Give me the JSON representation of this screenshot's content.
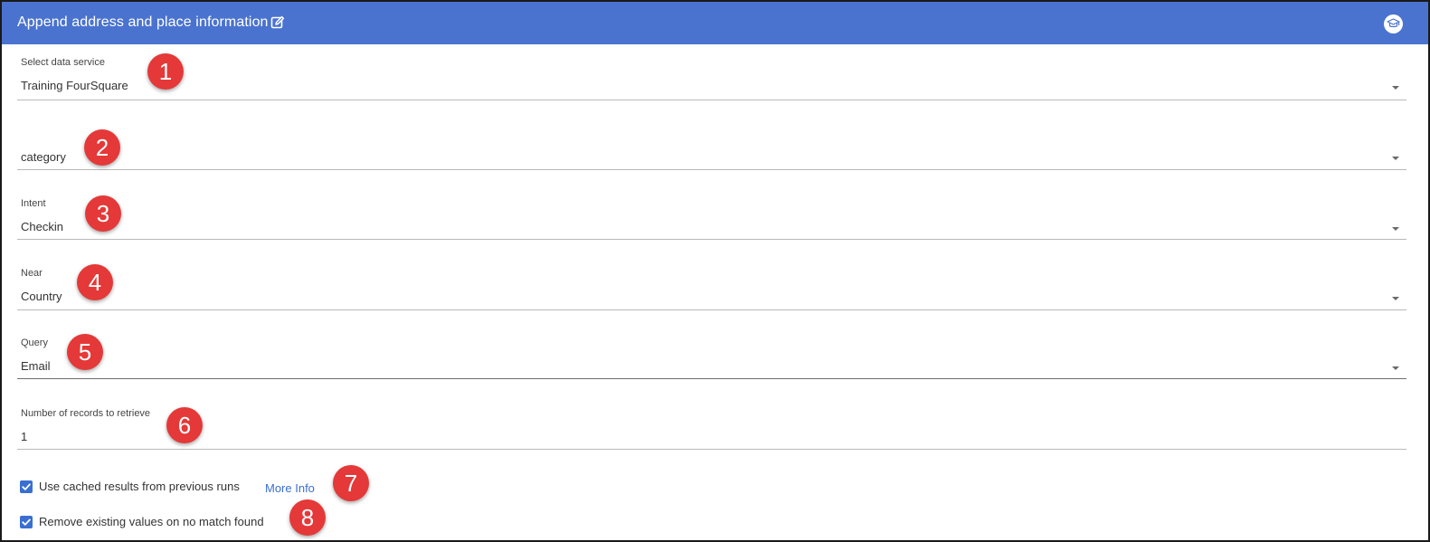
{
  "header": {
    "title": "Append address and place information"
  },
  "fields": {
    "data_service": {
      "label": "Select data service",
      "value": "Training FourSquare"
    },
    "category": {
      "value": "category"
    },
    "intent": {
      "label": "Intent",
      "value": "Checkin"
    },
    "near": {
      "label": "Near",
      "value": "Country"
    },
    "query": {
      "label": "Query",
      "value": "Email"
    },
    "records": {
      "label": "Number of records to retrieve",
      "value": "1"
    }
  },
  "options": {
    "cached": {
      "label": "Use cached results from previous runs",
      "checked": true,
      "link": "More Info"
    },
    "remove": {
      "label": "Remove existing values on no match found",
      "checked": true
    }
  },
  "badges": [
    "1",
    "2",
    "3",
    "4",
    "5",
    "6",
    "7",
    "8"
  ],
  "colors": {
    "header": "#4a73cf",
    "accent": "#3a6fd1",
    "badge": "#e53838"
  }
}
